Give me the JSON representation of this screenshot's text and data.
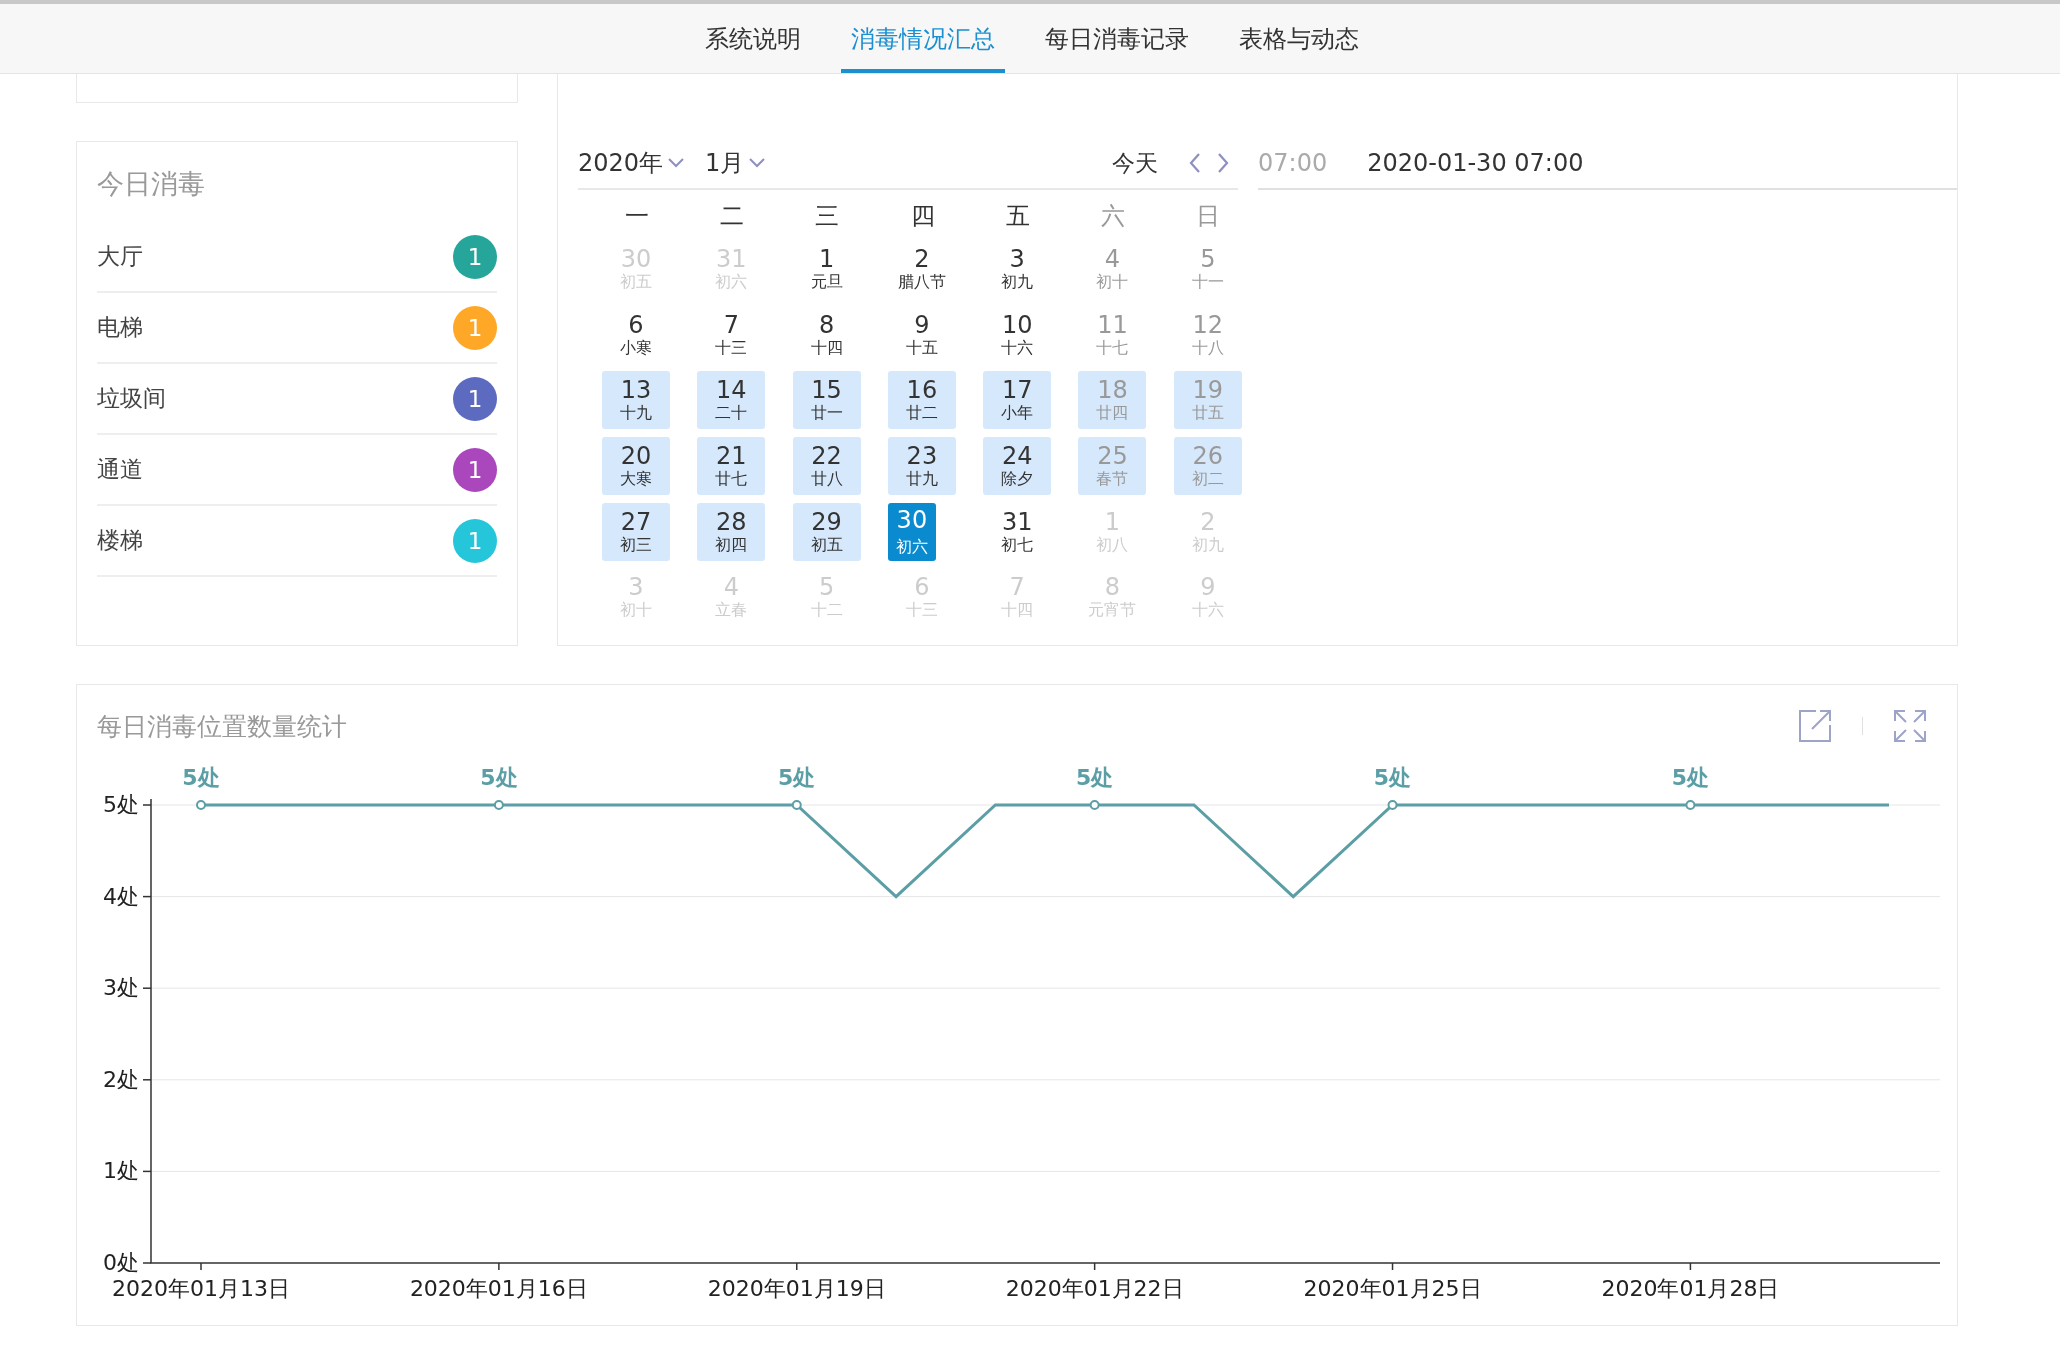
{
  "tabs": [
    {
      "label": "系统说明",
      "selected": false
    },
    {
      "label": "消毒情况汇总",
      "selected": true
    },
    {
      "label": "每日消毒记录",
      "selected": false
    },
    {
      "label": "表格与动态",
      "selected": false
    }
  ],
  "today_panel": {
    "title": "今日消毒",
    "items": [
      {
        "name": "大厅",
        "count": "1",
        "color": "#26a69a"
      },
      {
        "name": "电梯",
        "count": "1",
        "color": "#ffa726"
      },
      {
        "name": "垃圾间",
        "count": "1",
        "color": "#5c6bc0"
      },
      {
        "name": "通道",
        "count": "1",
        "color": "#ab47bc"
      },
      {
        "name": "楼梯",
        "count": "1",
        "color": "#26c6da"
      }
    ]
  },
  "calendar": {
    "year": "2020年",
    "month": "1月",
    "today_button": "今天",
    "time": "07:00",
    "selected_datetime": "2020-01-30 07:00",
    "weekdays": [
      "一",
      "二",
      "三",
      "四",
      "五",
      "六",
      "日"
    ],
    "weeks": [
      [
        {
          "day": "30",
          "lunar": "初五",
          "in_month": false,
          "marked": false,
          "selected": false
        },
        {
          "day": "31",
          "lunar": "初六",
          "in_month": false,
          "marked": false,
          "selected": false
        },
        {
          "day": "1",
          "lunar": "元旦",
          "in_month": true,
          "marked": false,
          "selected": false
        },
        {
          "day": "2",
          "lunar": "腊八节",
          "in_month": true,
          "marked": false,
          "selected": false
        },
        {
          "day": "3",
          "lunar": "初九",
          "in_month": true,
          "marked": false,
          "selected": false
        },
        {
          "day": "4",
          "lunar": "初十",
          "in_month": true,
          "marked": false,
          "selected": false
        },
        {
          "day": "5",
          "lunar": "十一",
          "in_month": true,
          "marked": false,
          "selected": false
        }
      ],
      [
        {
          "day": "6",
          "lunar": "小寒",
          "in_month": true,
          "marked": false,
          "selected": false
        },
        {
          "day": "7",
          "lunar": "十三",
          "in_month": true,
          "marked": false,
          "selected": false
        },
        {
          "day": "8",
          "lunar": "十四",
          "in_month": true,
          "marked": false,
          "selected": false
        },
        {
          "day": "9",
          "lunar": "十五",
          "in_month": true,
          "marked": false,
          "selected": false
        },
        {
          "day": "10",
          "lunar": "十六",
          "in_month": true,
          "marked": false,
          "selected": false
        },
        {
          "day": "11",
          "lunar": "十七",
          "in_month": true,
          "marked": false,
          "selected": false
        },
        {
          "day": "12",
          "lunar": "十八",
          "in_month": true,
          "marked": false,
          "selected": false
        }
      ],
      [
        {
          "day": "13",
          "lunar": "十九",
          "in_month": true,
          "marked": true,
          "selected": false
        },
        {
          "day": "14",
          "lunar": "二十",
          "in_month": true,
          "marked": true,
          "selected": false
        },
        {
          "day": "15",
          "lunar": "廿一",
          "in_month": true,
          "marked": true,
          "selected": false
        },
        {
          "day": "16",
          "lunar": "廿二",
          "in_month": true,
          "marked": true,
          "selected": false
        },
        {
          "day": "17",
          "lunar": "小年",
          "in_month": true,
          "marked": true,
          "selected": false
        },
        {
          "day": "18",
          "lunar": "廿四",
          "in_month": true,
          "marked": true,
          "selected": false
        },
        {
          "day": "19",
          "lunar": "廿五",
          "in_month": true,
          "marked": true,
          "selected": false
        }
      ],
      [
        {
          "day": "20",
          "lunar": "大寒",
          "in_month": true,
          "marked": true,
          "selected": false
        },
        {
          "day": "21",
          "lunar": "廿七",
          "in_month": true,
          "marked": true,
          "selected": false
        },
        {
          "day": "22",
          "lunar": "廿八",
          "in_month": true,
          "marked": true,
          "selected": false
        },
        {
          "day": "23",
          "lunar": "廿九",
          "in_month": true,
          "marked": true,
          "selected": false
        },
        {
          "day": "24",
          "lunar": "除夕",
          "in_month": true,
          "marked": true,
          "selected": false
        },
        {
          "day": "25",
          "lunar": "春节",
          "in_month": true,
          "marked": true,
          "selected": false
        },
        {
          "day": "26",
          "lunar": "初二",
          "in_month": true,
          "marked": true,
          "selected": false
        }
      ],
      [
        {
          "day": "27",
          "lunar": "初三",
          "in_month": true,
          "marked": true,
          "selected": false
        },
        {
          "day": "28",
          "lunar": "初四",
          "in_month": true,
          "marked": true,
          "selected": false
        },
        {
          "day": "29",
          "lunar": "初五",
          "in_month": true,
          "marked": true,
          "selected": false
        },
        {
          "day": "30",
          "lunar": "初六",
          "in_month": true,
          "marked": true,
          "selected": true
        },
        {
          "day": "31",
          "lunar": "初七",
          "in_month": true,
          "marked": false,
          "selected": false
        },
        {
          "day": "1",
          "lunar": "初八",
          "in_month": false,
          "marked": false,
          "selected": false
        },
        {
          "day": "2",
          "lunar": "初九",
          "in_month": false,
          "marked": false,
          "selected": false
        }
      ],
      [
        {
          "day": "3",
          "lunar": "初十",
          "in_month": false,
          "marked": false,
          "selected": false
        },
        {
          "day": "4",
          "lunar": "立春",
          "in_month": false,
          "marked": false,
          "selected": false
        },
        {
          "day": "5",
          "lunar": "十二",
          "in_month": false,
          "marked": false,
          "selected": false
        },
        {
          "day": "6",
          "lunar": "十三",
          "in_month": false,
          "marked": false,
          "selected": false
        },
        {
          "day": "7",
          "lunar": "十四",
          "in_month": false,
          "marked": false,
          "selected": false
        },
        {
          "day": "8",
          "lunar": "元宵节",
          "in_month": false,
          "marked": false,
          "selected": false
        },
        {
          "day": "9",
          "lunar": "十六",
          "in_month": false,
          "marked": false,
          "selected": false
        }
      ]
    ]
  },
  "chart_panel": {
    "title": "每日消毒位置数量统计",
    "chart_data": {
      "type": "line",
      "categories": [
        "2020年01月13日",
        null,
        null,
        "2020年01月16日",
        null,
        null,
        "2020年01月19日",
        null,
        null,
        "2020年01月22日",
        null,
        null,
        "2020年01月25日",
        null,
        null,
        "2020年01月28日",
        null,
        null
      ],
      "grid": true,
      "series": [
        {
          "color": "#5b9ea6",
          "values": [
            5,
            5,
            5,
            5,
            5,
            5,
            5,
            4,
            5,
            5,
            5,
            4,
            5,
            5,
            5,
            5,
            5,
            5
          ]
        }
      ],
      "ylim": [
        0,
        5
      ],
      "yticks": [
        {
          "value": 0,
          "label": "0处"
        },
        {
          "value": 1,
          "label": "1处"
        },
        {
          "value": 2,
          "label": "2处"
        },
        {
          "value": 3,
          "label": "3处"
        },
        {
          "value": 4,
          "label": "4处"
        },
        {
          "value": 5,
          "label": "5处"
        }
      ],
      "value_labels": [
        "5处",
        null,
        null,
        "5处",
        null,
        null,
        "5处",
        null,
        null,
        "5处",
        null,
        null,
        "5处",
        null,
        null,
        "5处",
        null,
        null
      ]
    }
  }
}
